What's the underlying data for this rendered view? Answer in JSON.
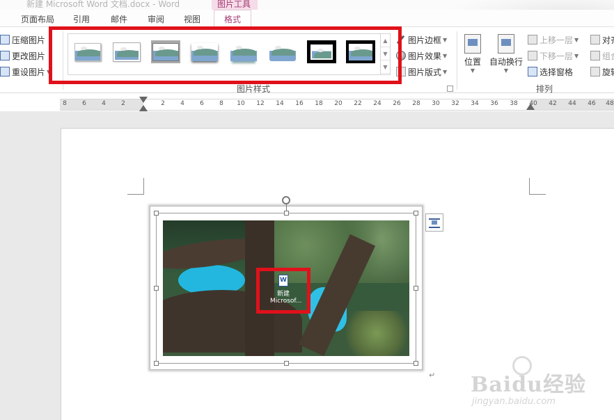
{
  "window": {
    "title": "新建 Microsoft Word 文档.docx - Word",
    "context_group": "图片工具"
  },
  "tabs": [
    {
      "label": "页面布局"
    },
    {
      "label": "引用"
    },
    {
      "label": "邮件"
    },
    {
      "label": "审阅"
    },
    {
      "label": "视图"
    },
    {
      "label": "格式",
      "active": true
    }
  ],
  "ribbon": {
    "adjust": {
      "compress": "压缩图片",
      "change": "更改图片",
      "reset": "重设图片"
    },
    "picture_styles": {
      "group_label": "图片样式",
      "border": "图片边框",
      "effects": "图片效果",
      "layout": "图片版式",
      "thumbnail_count": 8
    },
    "arrange": {
      "group_label": "排列",
      "position": "位置",
      "wrap_text": "自动换行",
      "bring_forward": "上移一层",
      "send_backward": "下移一层",
      "selection_pane": "选择窗格",
      "align": "对齐",
      "group": "组合",
      "rotate": "旋转"
    }
  },
  "ruler": {
    "ticks": [
      "8",
      "6",
      "4",
      "2",
      "2",
      "4",
      "6",
      "8",
      "10",
      "12",
      "14",
      "16",
      "18",
      "20",
      "22",
      "24",
      "26",
      "28",
      "30",
      "32",
      "34",
      "36",
      "38",
      "40",
      "42",
      "44",
      "46",
      "48"
    ]
  },
  "document": {
    "picture_icon_label_1": "新建",
    "picture_icon_label_2": "Microsof..."
  },
  "watermark": {
    "brand": "Baidu经验",
    "url": "jingyan.baidu.com"
  },
  "colors": {
    "accent_context": "#a23b73",
    "annotation_red": "#e0111b",
    "sky": "#23b7e0"
  }
}
